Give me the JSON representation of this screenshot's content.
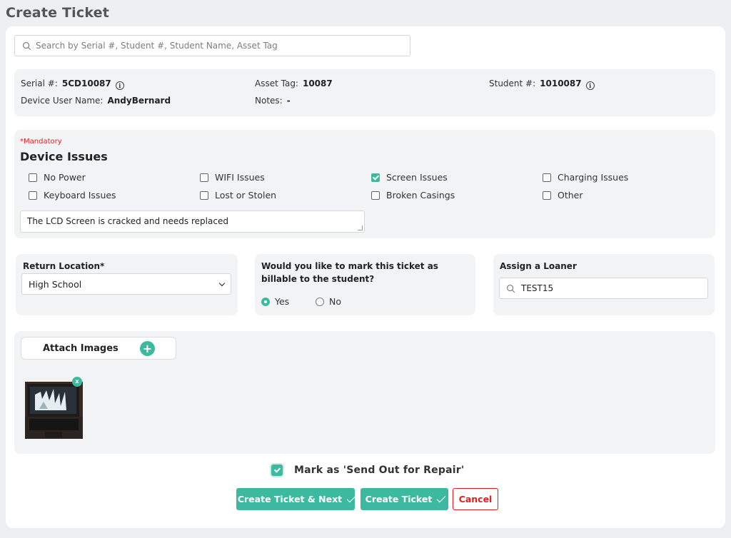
{
  "page": {
    "title": "Create Ticket"
  },
  "search": {
    "placeholder": "Search by Serial #, Student #, Student Name, Asset Tag"
  },
  "device_info": {
    "serial_label": "Serial #:",
    "serial_value": "5CD10087",
    "asset_tag_label": "Asset Tag:",
    "asset_tag_value": "10087",
    "student_label": "Student #:",
    "student_value": "1010087",
    "user_name_label": "Device User Name:",
    "user_name_value": "AndyBernard",
    "notes_label": "Notes:",
    "notes_value": "-",
    "info_glyph": "i"
  },
  "issues": {
    "mandatory_text": "*Mandatory",
    "title": "Device Issues",
    "options": [
      {
        "label": "No Power",
        "checked": false
      },
      {
        "label": "WIFI Issues",
        "checked": false
      },
      {
        "label": "Screen Issues",
        "checked": true
      },
      {
        "label": "Charging Issues",
        "checked": false
      },
      {
        "label": "Keyboard Issues",
        "checked": false
      },
      {
        "label": "Lost or Stolen",
        "checked": false
      },
      {
        "label": "Broken Casings",
        "checked": false
      },
      {
        "label": "Other",
        "checked": false
      }
    ],
    "description": "The LCD Screen is cracked and needs replaced"
  },
  "return_location": {
    "label": "Return Location*",
    "selected": "High School"
  },
  "billable": {
    "question": "Would you like to mark this ticket as billable to the student?",
    "yes_label": "Yes",
    "no_label": "No",
    "selected": "Yes"
  },
  "loaner": {
    "label": "Assign a Loaner",
    "value": "TEST15"
  },
  "attachments": {
    "button_label": "Attach Images",
    "add_glyph": "+",
    "remove_glyph": "x",
    "image_count": 1
  },
  "repair": {
    "label": "Mark as 'Send Out for Repair'",
    "checked": true
  },
  "actions": {
    "create_next_label": "Create Ticket & Next",
    "create_label": "Create Ticket",
    "cancel_label": "Cancel"
  },
  "colors": {
    "accent": "#3db9a0",
    "danger": "#e02020",
    "panel": "#f2f3f5",
    "background": "#eeeff1"
  },
  "icons": {
    "search": "magnifier-icon",
    "info": "info-circle-icon",
    "add": "plus-circle-icon",
    "remove": "x-circle-icon",
    "check": "checkmark-icon"
  }
}
